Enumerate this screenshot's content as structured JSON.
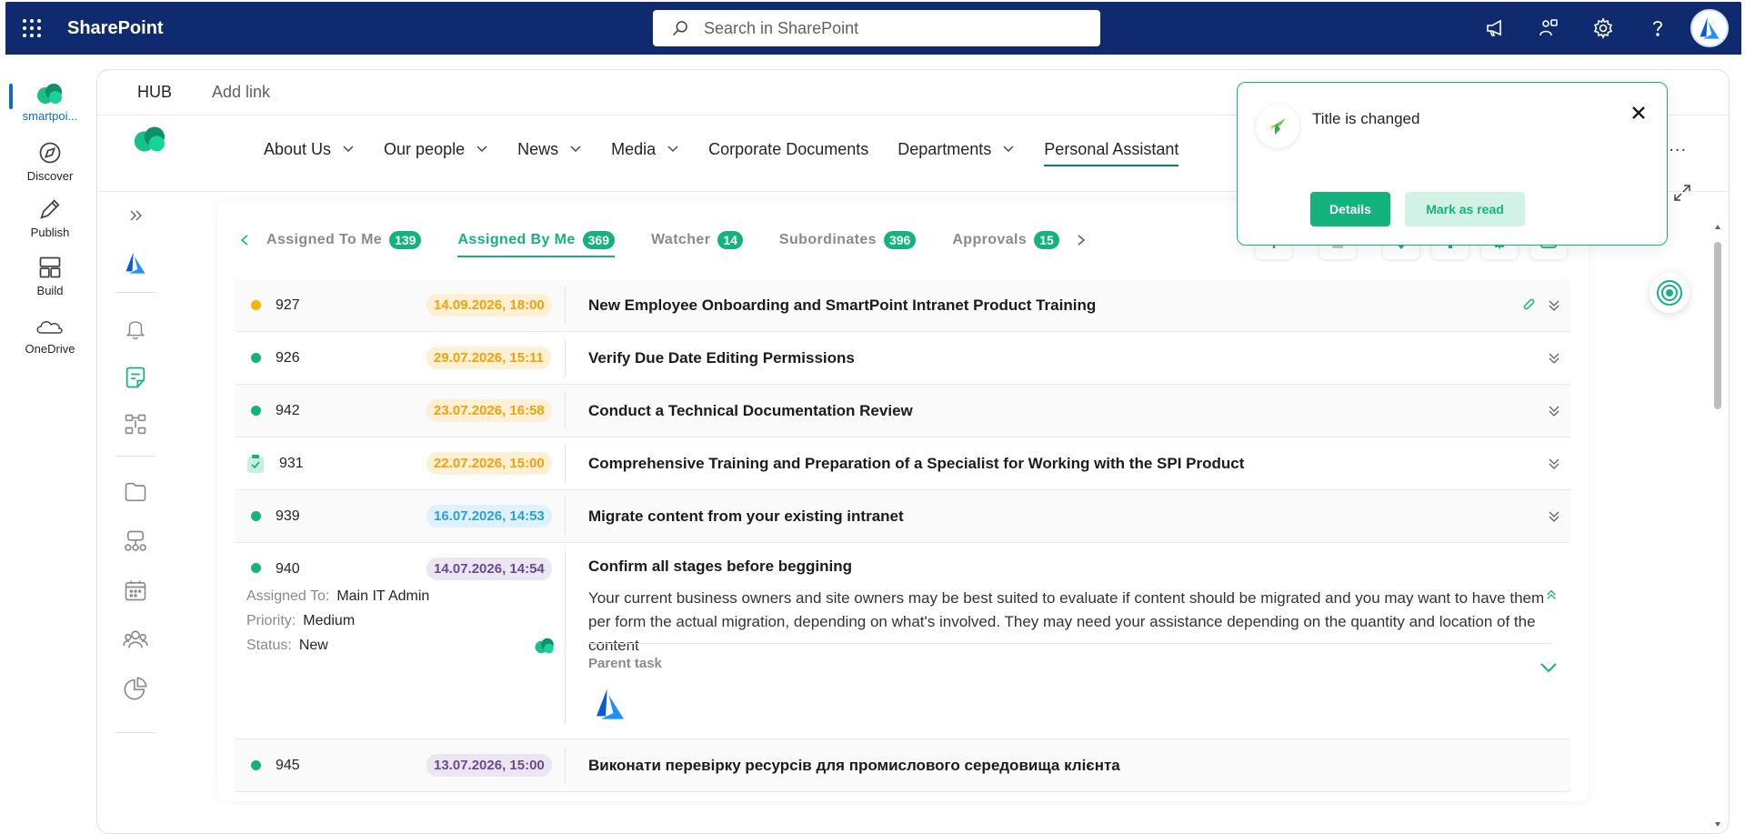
{
  "suitebar": {
    "brand": "SharePoint",
    "search_placeholder": "Search in SharePoint"
  },
  "appbar": {
    "items": [
      {
        "label": "smartpoi...",
        "icon": "site-icon"
      },
      {
        "label": "Discover",
        "icon": "discover-icon"
      },
      {
        "label": "Publish",
        "icon": "publish-icon"
      },
      {
        "label": "Build",
        "icon": "build-icon"
      },
      {
        "label": "OneDrive",
        "icon": "onedrive-icon"
      }
    ]
  },
  "hubbar": {
    "hub": "HUB",
    "add_link": "Add link"
  },
  "nav": {
    "items": [
      {
        "label": "About Us",
        "dropdown": true
      },
      {
        "label": "Our people",
        "dropdown": true
      },
      {
        "label": "News",
        "dropdown": true
      },
      {
        "label": "Media",
        "dropdown": true
      },
      {
        "label": "Corporate Documents",
        "dropdown": false
      },
      {
        "label": "Departments",
        "dropdown": true
      },
      {
        "label": "Personal Assistant",
        "dropdown": false,
        "active": true
      }
    ],
    "more": "..."
  },
  "tabs": [
    {
      "label": "Assigned To Me",
      "count": "139"
    },
    {
      "label": "Assigned By Me",
      "count": "369",
      "active": true
    },
    {
      "label": "Watcher",
      "count": "14"
    },
    {
      "label": "Subordinates",
      "count": "396"
    },
    {
      "label": "Approvals",
      "count": "15"
    }
  ],
  "tasks": [
    {
      "id": "927",
      "date": "14.09.2026, 18:00",
      "title": "New Employee Onboarding and SmartPoint Intranet Product Training",
      "status_color": "#f5b400",
      "date_bg": "#fdf0d5",
      "date_color": "#f0a20c",
      "attachment": true
    },
    {
      "id": "926",
      "date": "29.07.2026, 15:11",
      "title": "Verify Due Date Editing Permissions",
      "status_color": "#14b37d",
      "date_bg": "#fdf0d5",
      "date_color": "#f0a20c"
    },
    {
      "id": "942",
      "date": "23.07.2026, 16:58",
      "title": "Conduct a Technical Documentation Review",
      "status_color": "#14b37d",
      "date_bg": "#fdf0d5",
      "date_color": "#f0a20c"
    },
    {
      "id": "931",
      "date": "22.07.2026, 15:00",
      "title": "Comprehensive Training and Preparation of a Specialist for Working with the SPI Product",
      "status_icon": "clipboard-check-icon",
      "date_bg": "#fdf0d5",
      "date_color": "#f0a20c"
    },
    {
      "id": "939",
      "date": "16.07.2026, 14:53",
      "title": "Migrate content from your existing intranet",
      "status_color": "#14b37d",
      "date_bg": "#dff1fb",
      "date_color": "#2a9fd8"
    }
  ],
  "open_task": {
    "id": "940",
    "date": "14.07.2026, 14:54",
    "title": "Confirm all stages before beggining",
    "status_color": "#14b37d",
    "date_bg": "#ece6f3",
    "date_color": "#6a4a8c",
    "assigned_to_label": "Assigned To:",
    "assigned_to": "Main IT Admin",
    "priority_label": "Priority:",
    "priority": "Medium",
    "status_label": "Status:",
    "status": "New",
    "description": "Your current business owners and site owners may be best suited to evaluate if content should be migrated and you may want to have them per form the actual migration, depending on what's involved. They may need your assistance depending on the quantity and location of the content",
    "parent_label": "Parent task"
  },
  "next_task": {
    "id": "945",
    "date": "13.07.2026, 15:00",
    "title": "Виконати перевірку ресурсів для промислового середовища клієнта"
  },
  "toast": {
    "title": "Title is changed",
    "details": "Details",
    "mark_read": "Mark as read"
  },
  "colors": {
    "suitebar": "#0f2a6e",
    "accent": "#14b37d",
    "nav_underline": "#0f7a6e"
  }
}
